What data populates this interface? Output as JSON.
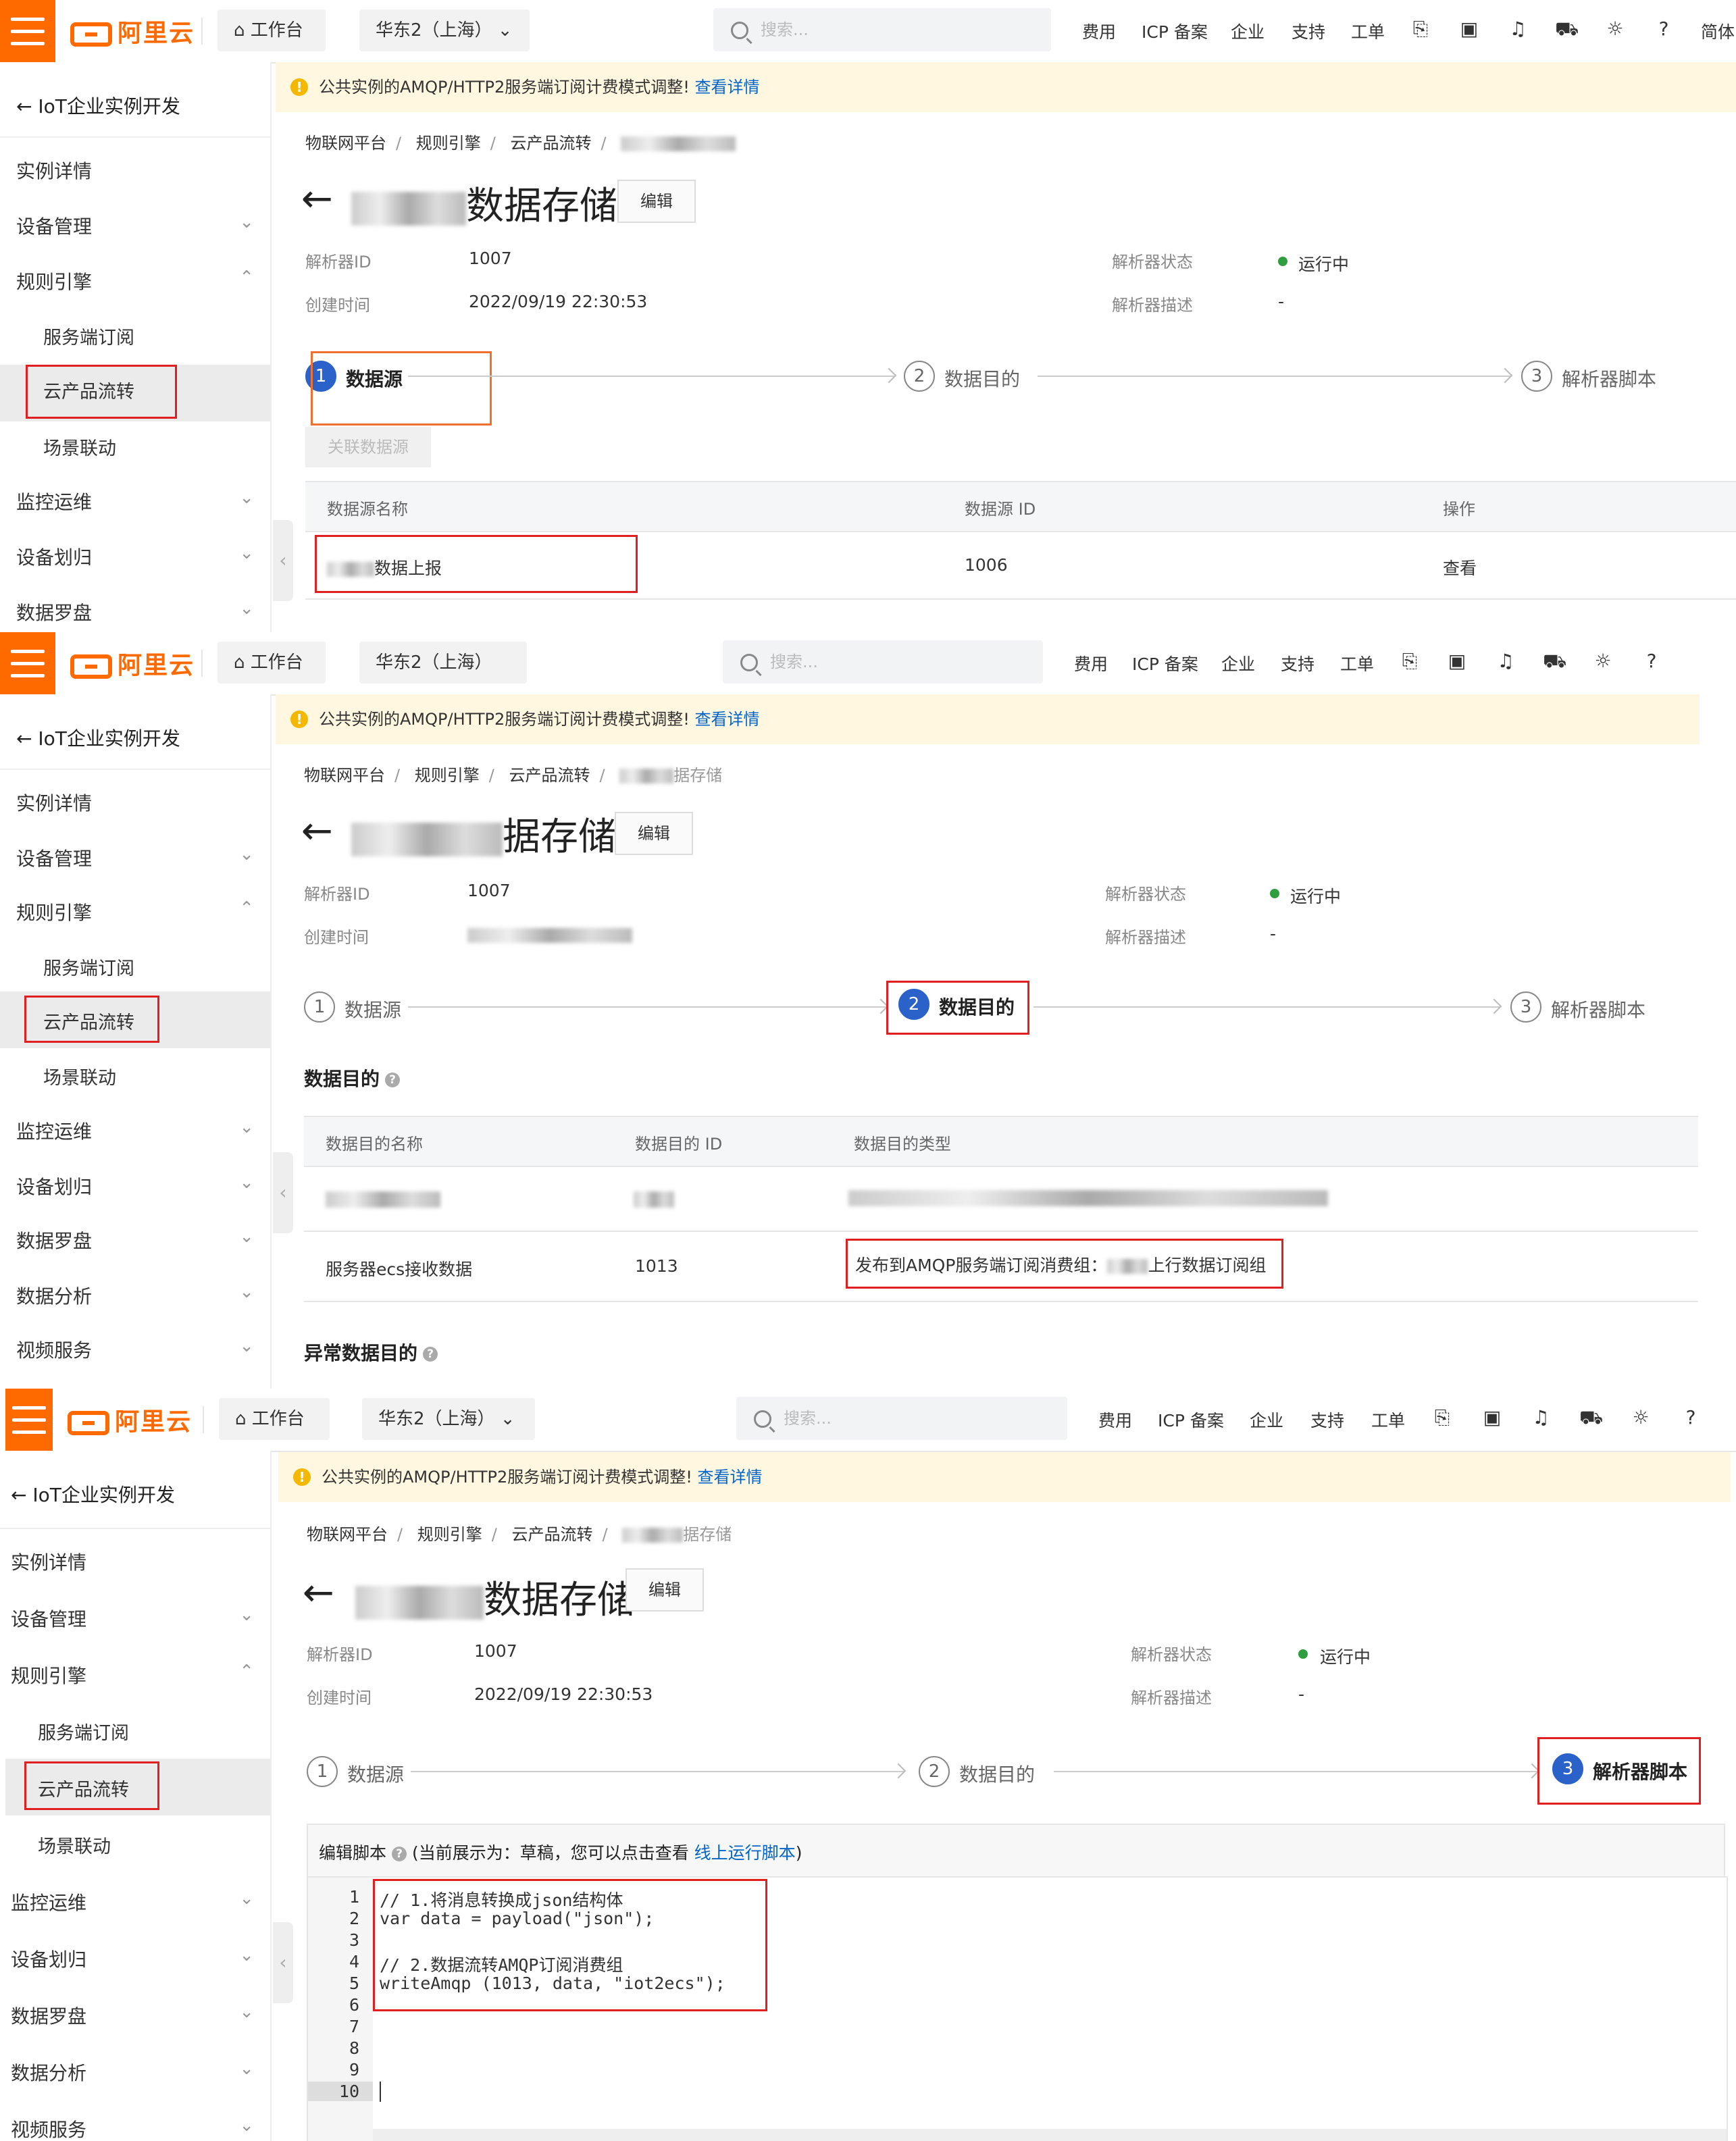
{
  "header": {
    "logo_text": "阿里云",
    "workbench": "工作台",
    "region": "华东2（上海）",
    "search_placeholder": "搜索...",
    "nav": [
      "费用",
      "ICP 备案",
      "企业",
      "支持",
      "工单"
    ],
    "lang": "简体",
    "brand_color": "#ff6a00"
  },
  "sidebar": {
    "back_label": "IoT企业实例开发",
    "items": [
      "实例详情",
      "设备管理",
      "规则引擎",
      "服务端订阅",
      "云产品流转",
      "场景联动",
      "监控运维",
      "设备划归",
      "数据罗盘",
      "数据分析",
      "视频服务"
    ]
  },
  "notice": {
    "text": "公共实例的AMQP/HTTP2服务端订阅计费模式调整!",
    "link": "查看详情"
  },
  "breadcrumb": [
    "物联网平台",
    "规则引擎",
    "云产品流转"
  ],
  "breadcrumb_tail": "据存储",
  "page": {
    "title_suffix": "数据存储",
    "title_suffix_short": "据存储",
    "edit_button": "编辑",
    "parser_id_label": "解析器ID",
    "parser_id": "1007",
    "created_label": "创建时间",
    "created": "2022/09/19 22:30:53",
    "status_label": "解析器状态",
    "status": "运行中",
    "desc_label": "解析器描述",
    "desc": "-"
  },
  "steps": [
    {
      "num": "1",
      "label": "数据源"
    },
    {
      "num": "2",
      "label": "数据目的"
    },
    {
      "num": "3",
      "label": "解析器脚本"
    }
  ],
  "source": {
    "link_button": "关联数据源",
    "headers": [
      "数据源名称",
      "数据源 ID",
      "操作"
    ],
    "row": {
      "name": "数据上报",
      "id": "1006",
      "action": "查看"
    }
  },
  "destination": {
    "section_title": "数据目的",
    "headers": [
      "数据目的名称",
      "数据目的 ID",
      "数据目的类型"
    ],
    "row": {
      "name": "服务器ecs接收数据",
      "id": "1013",
      "type": "发布到AMQP服务端订阅消费组：",
      "type_suffix": "上行数据订阅组"
    },
    "error_title": "异常数据目的"
  },
  "script": {
    "label": "编辑脚本",
    "hint_prefix": "(当前展示为：草稿，您可以点击查看 ",
    "hint_link": "线上运行脚本",
    "hint_suffix": ")",
    "lines": [
      "// 1.将消息转换成json结构体",
      "var data = payload(\"json\");",
      "",
      "// 2.数据流转AMQP订阅消费组",
      "writeAmqp (1013, data, \"iot2ecs\");",
      "",
      "",
      "",
      "",
      ""
    ],
    "line_numbers": [
      "1",
      "2",
      "3",
      "4",
      "5",
      "6",
      "7",
      "8",
      "9",
      "10"
    ]
  }
}
